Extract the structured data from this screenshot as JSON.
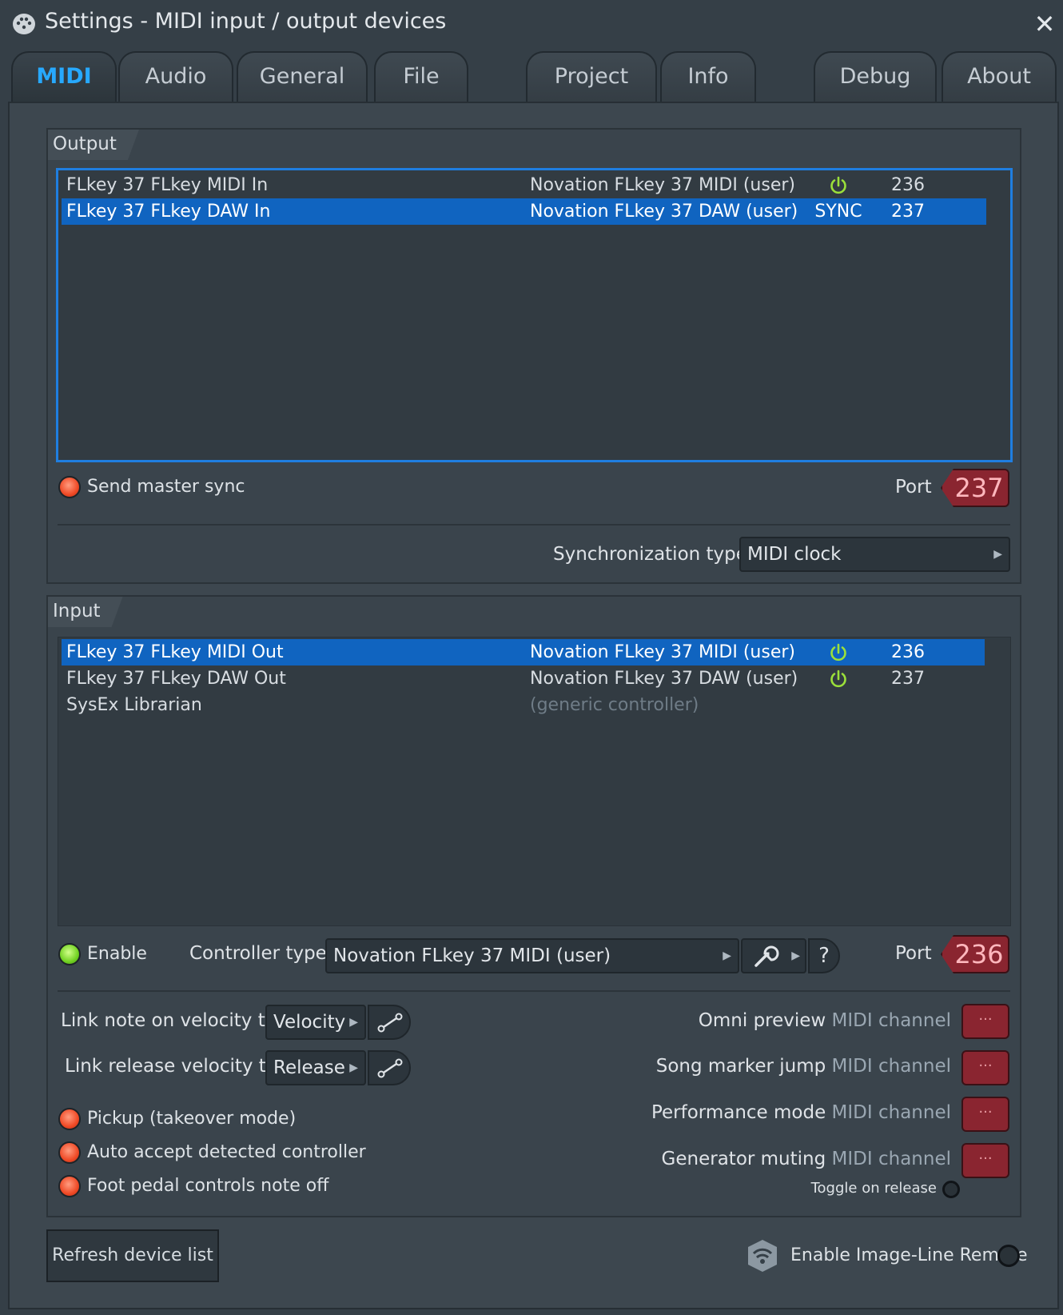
{
  "window": {
    "title": "Settings - MIDI input / output devices",
    "close": "✕"
  },
  "tabs": [
    "MIDI",
    "Audio",
    "General",
    "File",
    "Project",
    "Info",
    "Debug",
    "About"
  ],
  "output": {
    "label": "Output",
    "rows": [
      {
        "name": "FLkey 37 FLkey MIDI In",
        "controller": "Novation FLkey 37 MIDI (user)",
        "status": "power",
        "port": "236",
        "selected": false
      },
      {
        "name": "FLkey 37 FLkey DAW In",
        "controller": "Novation FLkey 37 DAW (user)",
        "status": "SYNC",
        "port": "237",
        "selected": true
      }
    ],
    "send_master_sync": "Send master sync",
    "port_label": "Port",
    "port_value": "237",
    "sync_type_label": "Synchronization type",
    "sync_type_value": "MIDI clock"
  },
  "input": {
    "label": "Input",
    "rows": [
      {
        "name": "FLkey 37 FLkey MIDI Out",
        "controller": "Novation FLkey 37 MIDI (user)",
        "status": "power",
        "port": "236",
        "selected": true
      },
      {
        "name": "FLkey 37 FLkey DAW Out",
        "controller": "Novation FLkey 37 DAW (user)",
        "status": "power",
        "port": "237",
        "selected": false
      },
      {
        "name": "SysEx Librarian",
        "controller": "(generic controller)",
        "status": "",
        "port": "",
        "selected": false
      }
    ],
    "enable_label": "Enable",
    "controller_type_label": "Controller type",
    "controller_type_value": "Novation FLkey 37 MIDI (user)",
    "help": "?",
    "port_label": "Port",
    "port_value": "236",
    "link_note_on_label": "Link note on velocity to",
    "link_note_on_value": "Velocity",
    "link_release_label": "Link release velocity to",
    "link_release_value": "Release",
    "checks": [
      "Pickup (takeover mode)",
      "Auto accept detected controller",
      "Foot pedal controls note off"
    ],
    "channels": [
      {
        "name": "Omni preview",
        "suffix": "MIDI channel",
        "value": "···"
      },
      {
        "name": "Song marker jump",
        "suffix": "MIDI channel",
        "value": "···"
      },
      {
        "name": "Performance mode",
        "suffix": "MIDI channel",
        "value": "···"
      },
      {
        "name": "Generator muting",
        "suffix": "MIDI channel",
        "value": "···"
      }
    ],
    "toggle_on_release": "Toggle on release"
  },
  "footer": {
    "refresh": "Refresh device list",
    "remote": "Enable Image-Line Remote"
  },
  "colors": {
    "accent": "#1064c0",
    "active_tab": "#27a9ff",
    "port_box": "#8a2530",
    "power_icon": "#9be03a"
  }
}
